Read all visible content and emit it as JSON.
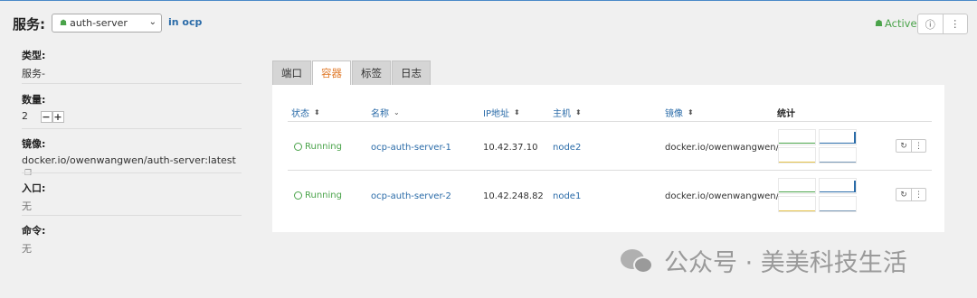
{
  "header": {
    "title": "服务:",
    "service_select": "auth-server",
    "namespace": "in ocp",
    "status": "Active",
    "help_icon": "help-icon",
    "more_icon": "kebab-icon"
  },
  "details": {
    "type_label": "类型:",
    "type_value": "服务-",
    "count_label": "数量:",
    "count_value": "2",
    "image_label": "镜像:",
    "image_value": "docker.io/owenwangwen/auth-server:latest",
    "entry_label": "入口:",
    "entry_value": "无",
    "command_label": "命令:",
    "command_value": "无"
  },
  "tabs": [
    "端口",
    "容器",
    "标签",
    "日志"
  ],
  "active_tab": "容器",
  "table": {
    "columns": [
      "状态",
      "名称",
      "IP地址",
      "主机",
      "镜像",
      "统计"
    ],
    "rows": [
      {
        "status": "Running",
        "name": "ocp-auth-server-1",
        "ip": "10.42.37.10",
        "host": "node2",
        "image": "docker.io/owenwangwen/..."
      },
      {
        "status": "Running",
        "name": "ocp-auth-server-2",
        "ip": "10.42.248.82",
        "host": "node1",
        "image": "docker.io/owenwangwen/..."
      }
    ]
  },
  "watermark": {
    "text": "公众号 · 美美科技生活"
  },
  "colors": {
    "accent": "#2a6ba8",
    "active_tab": "#e07b2c",
    "success": "#4aa34a"
  }
}
